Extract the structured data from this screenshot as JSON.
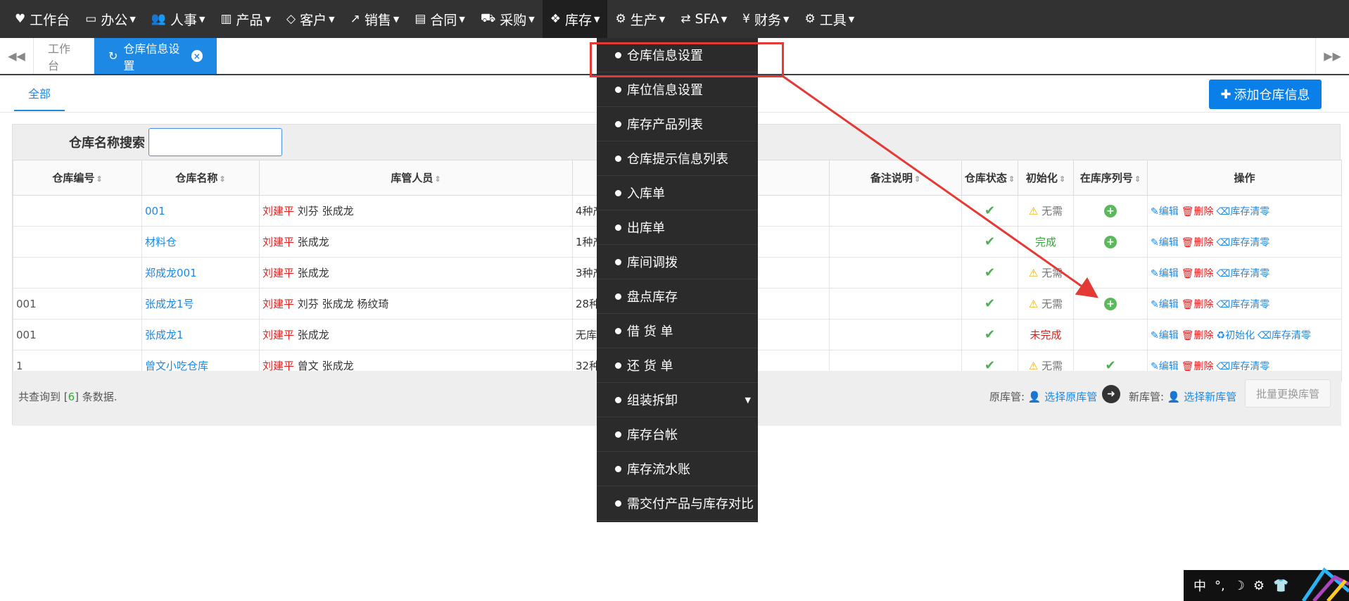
{
  "nav": [
    {
      "icon": "heart-icon",
      "glyph": "♥",
      "label": "工作台",
      "caret": false
    },
    {
      "icon": "laptop-icon",
      "glyph": "▭",
      "label": "办公",
      "caret": true
    },
    {
      "icon": "users-icon",
      "glyph": "👥",
      "label": "人事",
      "caret": true
    },
    {
      "icon": "barcode-icon",
      "glyph": "▥",
      "label": "产品",
      "caret": true
    },
    {
      "icon": "diamond-icon",
      "glyph": "◇",
      "label": "客户",
      "caret": true
    },
    {
      "icon": "chart-icon",
      "glyph": "↗",
      "label": "销售",
      "caret": true
    },
    {
      "icon": "contract-icon",
      "glyph": "▤",
      "label": "合同",
      "caret": true
    },
    {
      "icon": "cart-icon",
      "glyph": "⛟",
      "label": "采购",
      "caret": true
    },
    {
      "icon": "cubes-icon",
      "glyph": "❖",
      "label": "库存",
      "caret": true,
      "active": true
    },
    {
      "icon": "cogs-icon",
      "glyph": "⚙",
      "label": "生产",
      "caret": true
    },
    {
      "icon": "exchange-icon",
      "glyph": "⇄",
      "label": "SFA",
      "caret": true
    },
    {
      "icon": "yen-icon",
      "glyph": "¥",
      "label": "财务",
      "caret": true
    },
    {
      "icon": "gear-icon",
      "glyph": "⚙",
      "label": "工具",
      "caret": true
    }
  ],
  "tabs": {
    "home": "工作台",
    "current": "仓库信息设置"
  },
  "subtab_all": "全部",
  "add_button": "添加仓库信息",
  "search_label": "仓库名称搜索",
  "columns": [
    "仓库编号",
    "仓库名称",
    "库管人员",
    "",
    "备注说明",
    "仓库状态",
    "初始化",
    "在库序列号",
    "操作"
  ],
  "rows": [
    {
      "code": "",
      "name": "001",
      "mgr_lead": "刘建平",
      "mgr_rest": "刘芬 张成龙",
      "count": "4种产",
      "status": "✔",
      "init": "无需",
      "init_type": "warn",
      "serial": "plus",
      "ops": [
        "编辑",
        "删除",
        "库存清零"
      ]
    },
    {
      "code": "",
      "name": "材料仓",
      "mgr_lead": "刘建平",
      "mgr_rest": "张成龙",
      "count": "1种产",
      "status": "✔",
      "init": "完成",
      "init_type": "done",
      "serial": "plus",
      "ops": [
        "编辑",
        "删除",
        "库存清零"
      ]
    },
    {
      "code": "",
      "name": "郑成龙001",
      "mgr_lead": "刘建平",
      "mgr_rest": "张成龙",
      "count": "3种产",
      "status": "✔",
      "init": "无需",
      "init_type": "warn",
      "serial": "",
      "ops": [
        "编辑",
        "删除",
        "库存清零"
      ]
    },
    {
      "code": "001",
      "name": "张成龙1号",
      "mgr_lead": "刘建平",
      "mgr_rest": "刘芬 张成龙 杨纹琦",
      "count": "28种",
      "status": "✔",
      "init": "无需",
      "init_type": "warn",
      "serial": "plus",
      "ops": [
        "编辑",
        "删除",
        "库存清零"
      ]
    },
    {
      "code": "001",
      "name": "张成龙1",
      "mgr_lead": "刘建平",
      "mgr_rest": "张成龙",
      "count": "无库存",
      "status": "✔",
      "init": "未完成",
      "init_type": "notdone",
      "serial": "",
      "ops": [
        "编辑",
        "删除",
        "初始化",
        "库存清零"
      ]
    },
    {
      "code": "1",
      "name": "曾文小吃仓库",
      "mgr_lead": "刘建平",
      "mgr_rest": "曾文 张成龙",
      "count": "32种",
      "status": "✔",
      "init": "无需",
      "init_type": "warn",
      "serial": "check",
      "ops": [
        "编辑",
        "删除",
        "库存清零"
      ]
    }
  ],
  "footer": {
    "total_prefix": "共查询到 [",
    "total_count": "6",
    "total_suffix": "] 条数据.",
    "orig_label": "原库管:",
    "orig_link": "选择原库管",
    "new_label": "新库管:",
    "new_link": "选择新库管",
    "batch_button": "批量更换库管"
  },
  "dropdown": [
    {
      "label": "仓库信息设置"
    },
    {
      "label": "库位信息设置"
    },
    {
      "label": "库存产品列表"
    },
    {
      "label": "仓库提示信息列表"
    },
    {
      "label": "入库单"
    },
    {
      "label": "出库单"
    },
    {
      "label": "库间调拨"
    },
    {
      "label": "盘点库存"
    },
    {
      "label": "借 货 单"
    },
    {
      "label": "还 货 单"
    },
    {
      "label": "组装拆卸",
      "has_sub": true
    },
    {
      "label": "库存台帐"
    },
    {
      "label": "库存流水账"
    },
    {
      "label": "需交付产品与库存对比"
    }
  ],
  "tray": [
    "中",
    "°,",
    "☽",
    "⚙",
    "👕"
  ],
  "colors": {
    "nav_bg": "#323232",
    "accent": "#1e88e5",
    "danger": "#e02020",
    "highlight": "#e53935"
  }
}
